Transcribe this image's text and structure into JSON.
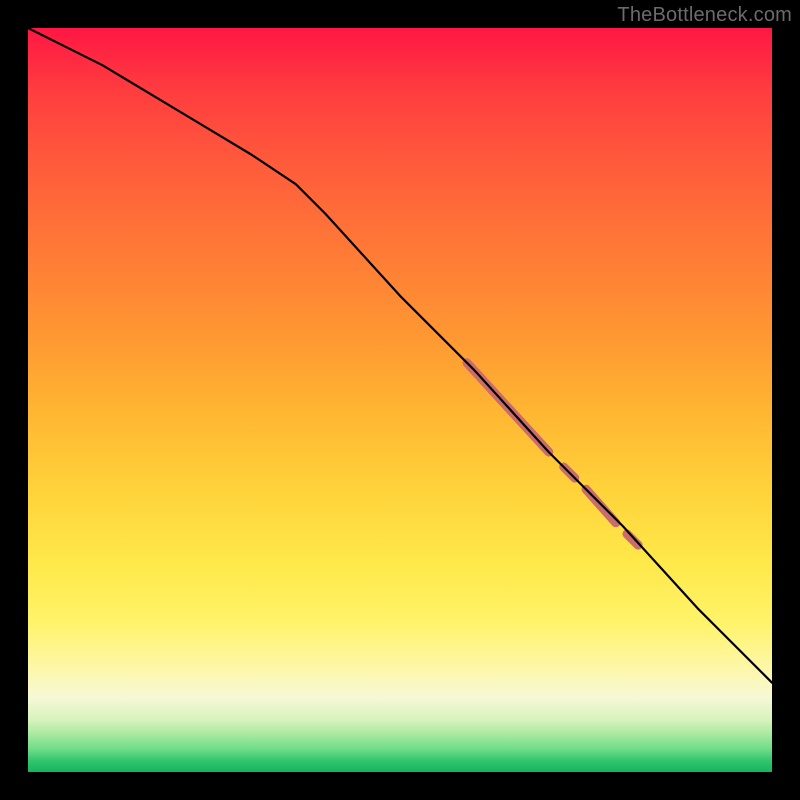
{
  "watermark": "TheBottleneck.com",
  "colors": {
    "background": "#000000",
    "curve": "#000000",
    "highlight": "#cc6b6b",
    "gradient_stops": [
      "#ff1744",
      "#ff3b3f",
      "#ff5a3c",
      "#ff7a36",
      "#ff9932",
      "#ffb732",
      "#ffd23a",
      "#ffe94a",
      "#fff36a",
      "#fdf7a8",
      "#f6f8d6",
      "#d6f3bd",
      "#a7e9a0",
      "#6cdc88",
      "#32c46e",
      "#14b55f"
    ]
  },
  "chart_data": {
    "type": "line",
    "title": "",
    "xlabel": "",
    "ylabel": "",
    "xlim": [
      0,
      100
    ],
    "ylim": [
      0,
      100
    ],
    "grid": false,
    "legend": false,
    "series": [
      {
        "name": "curve",
        "x": [
          0,
          10,
          20,
          30,
          36,
          40,
          50,
          60,
          70,
          80,
          90,
          100
        ],
        "y": [
          100,
          95,
          89,
          83,
          79,
          75,
          64,
          54,
          43,
          33,
          22,
          12
        ]
      }
    ],
    "highlight_segments": [
      {
        "x0": 59,
        "y0": 55,
        "x1": 70,
        "y1": 43,
        "width": 9
      },
      {
        "x0": 72,
        "y0": 41,
        "x1": 73.5,
        "y1": 39.5,
        "width": 9
      },
      {
        "x0": 75,
        "y0": 38,
        "x1": 79,
        "y1": 33.5,
        "width": 9
      },
      {
        "x0": 80.5,
        "y0": 32,
        "x1": 82,
        "y1": 30.5,
        "width": 9
      }
    ]
  }
}
